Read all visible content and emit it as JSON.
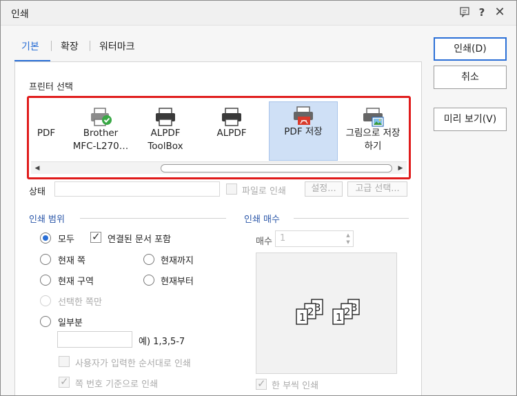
{
  "window": {
    "title": "인쇄"
  },
  "titlebar_icons": [
    "chat-icon",
    "help-icon",
    "close-icon"
  ],
  "tabs": [
    {
      "label": "기본",
      "active": true
    },
    {
      "label": "확장",
      "active": false
    },
    {
      "label": "워터마크",
      "active": false
    }
  ],
  "printer_section": {
    "label": "프린터 선택",
    "printers": [
      {
        "line1": "PDF",
        "line2": "",
        "selected": false,
        "icon": "printer-icon"
      },
      {
        "line1": "Brother",
        "line2": "MFC-L270…",
        "selected": false,
        "icon": "printer-check-icon"
      },
      {
        "line1": "ALPDF",
        "line2": "ToolBox",
        "selected": false,
        "icon": "printer-icon"
      },
      {
        "line1": "ALPDF",
        "line2": "",
        "selected": false,
        "icon": "printer-icon"
      },
      {
        "line1": "PDF 저장",
        "line2": "",
        "selected": true,
        "icon": "printer-pdf-icon"
      },
      {
        "line1": "그림으로 저장",
        "line2": "하기",
        "selected": false,
        "icon": "printer-image-icon"
      }
    ]
  },
  "status_row": {
    "status_label": "상태",
    "print_to_file": "파일로 인쇄",
    "settings_button": "설정...",
    "advanced_button": "고급 선택..."
  },
  "print_range": {
    "title": "인쇄 범위",
    "all": "모두",
    "include_linked": "연결된 문서 포함",
    "current_page": "현재 쪽",
    "up_to_current": "현재까지",
    "current_section": "현재 구역",
    "from_current": "현재부터",
    "selected_pages": "선택한 쪽만",
    "partial": "일부분",
    "example": "예) 1,3,5-7",
    "user_order": "사용자가 입력한 순서대로 인쇄",
    "page_number_basis": "쪽 번호 기준으로 인쇄"
  },
  "copies": {
    "title": "인쇄 매수",
    "label": "매수",
    "value": "1",
    "collate": "한 부씩 인쇄"
  },
  "buttons": {
    "print": "인쇄(D)",
    "cancel": "취소",
    "preview": "미리 보기(V)"
  }
}
